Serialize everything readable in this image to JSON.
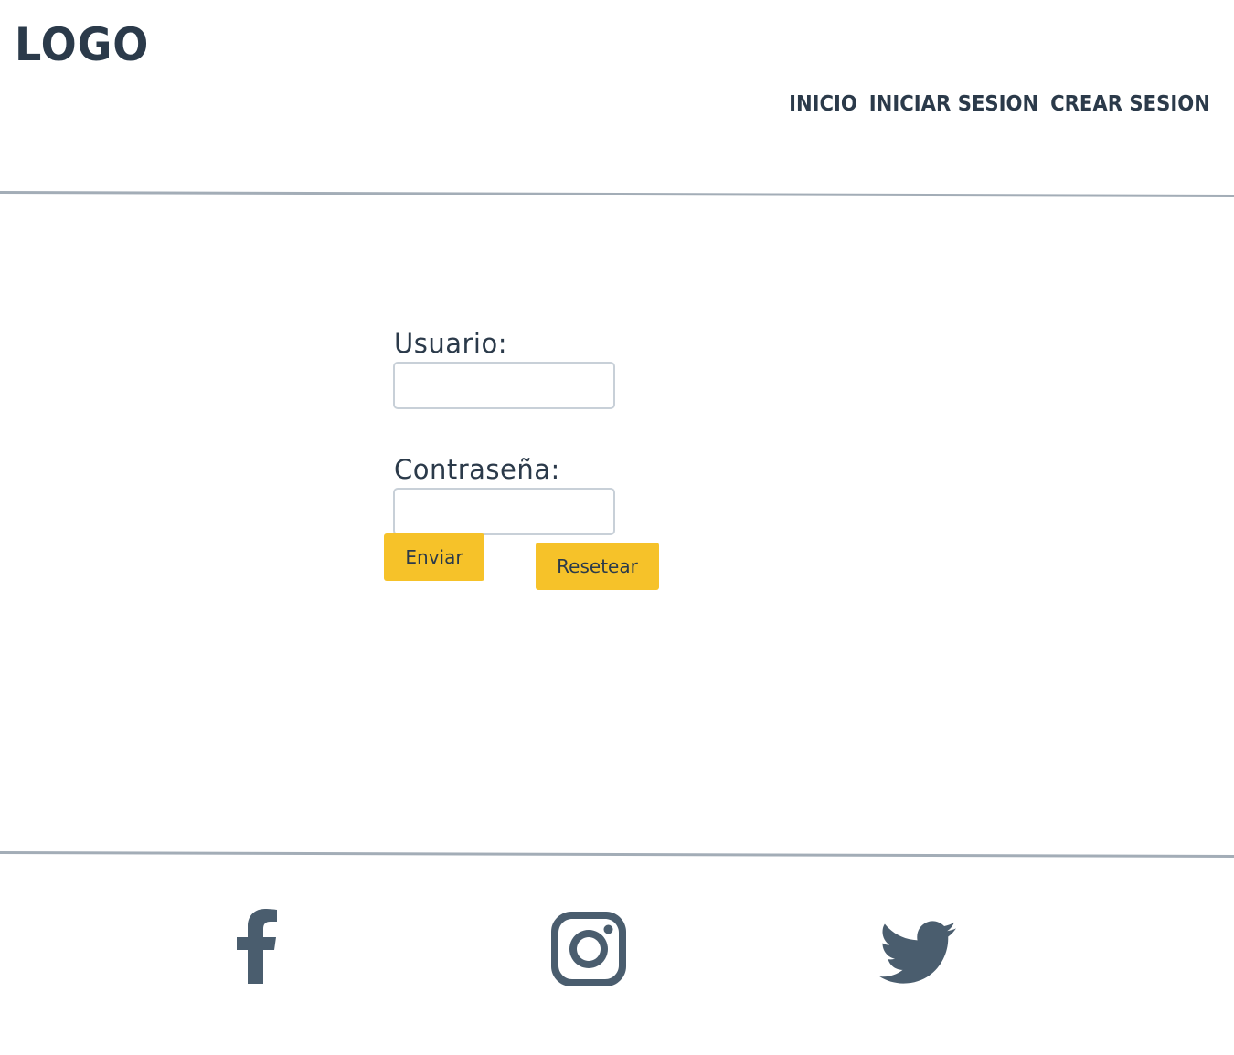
{
  "header": {
    "logo": "LOGO",
    "nav": [
      {
        "label": "INICIO"
      },
      {
        "label": "INICIAR SESION"
      },
      {
        "label": "CREAR SESION"
      }
    ]
  },
  "form": {
    "user_label": "Usuario:",
    "user_value": "",
    "pass_label": "Contraseña:",
    "pass_value": "",
    "submit_label": "Enviar",
    "reset_label": "Resetear"
  },
  "footer": {
    "icons": [
      "facebook-icon",
      "instagram-icon",
      "twitter-icon"
    ]
  },
  "colors": {
    "text": "#2b3a4a",
    "button": "#f6c229",
    "divider": "#a3adb7",
    "icon": "#4a5d6e"
  }
}
